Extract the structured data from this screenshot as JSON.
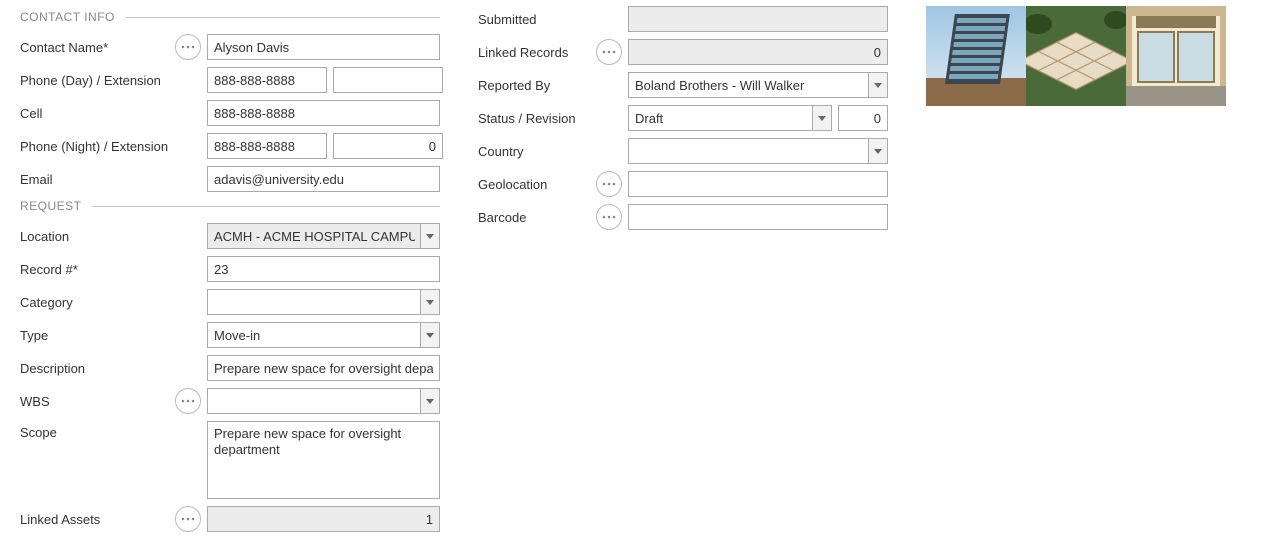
{
  "contact_info": {
    "title": "CONTACT INFO",
    "contact_name_label": "Contact Name*",
    "contact_name": "Alyson Davis",
    "phone_day_label": "Phone (Day) / Extension",
    "phone_day": "888-888-8888",
    "phone_day_ext": "",
    "cell_label": "Cell",
    "cell": "888-888-8888",
    "phone_night_label": "Phone (Night) / Extension",
    "phone_night": "888-888-8888",
    "phone_night_ext": "0",
    "email_label": "Email",
    "email": "adavis@university.edu"
  },
  "request": {
    "title": "REQUEST",
    "location_label": "Location",
    "location": "ACMH - ACME HOSPITAL CAMPUS",
    "record_label": "Record #*",
    "record": "23",
    "category_label": "Category",
    "category": "",
    "type_label": "Type",
    "type": "Move-in",
    "description_label": "Description",
    "description": "Prepare new space for oversight department",
    "wbs_label": "WBS",
    "wbs": "",
    "scope_label": "Scope",
    "scope": "Prepare new space for oversight department",
    "linked_assets_label": "Linked Assets",
    "linked_assets": "1"
  },
  "meta": {
    "submitted_label": "Submitted",
    "submitted": "",
    "linked_records_label": "Linked Records",
    "linked_records": "0",
    "reported_by_label": "Reported By",
    "reported_by": "Boland Brothers - Will Walker",
    "status_label": "Status / Revision",
    "status": "Draft",
    "revision": "0",
    "country_label": "Country",
    "country": "",
    "geolocation_label": "Geolocation",
    "geolocation": "",
    "barcode_label": "Barcode",
    "barcode": ""
  }
}
